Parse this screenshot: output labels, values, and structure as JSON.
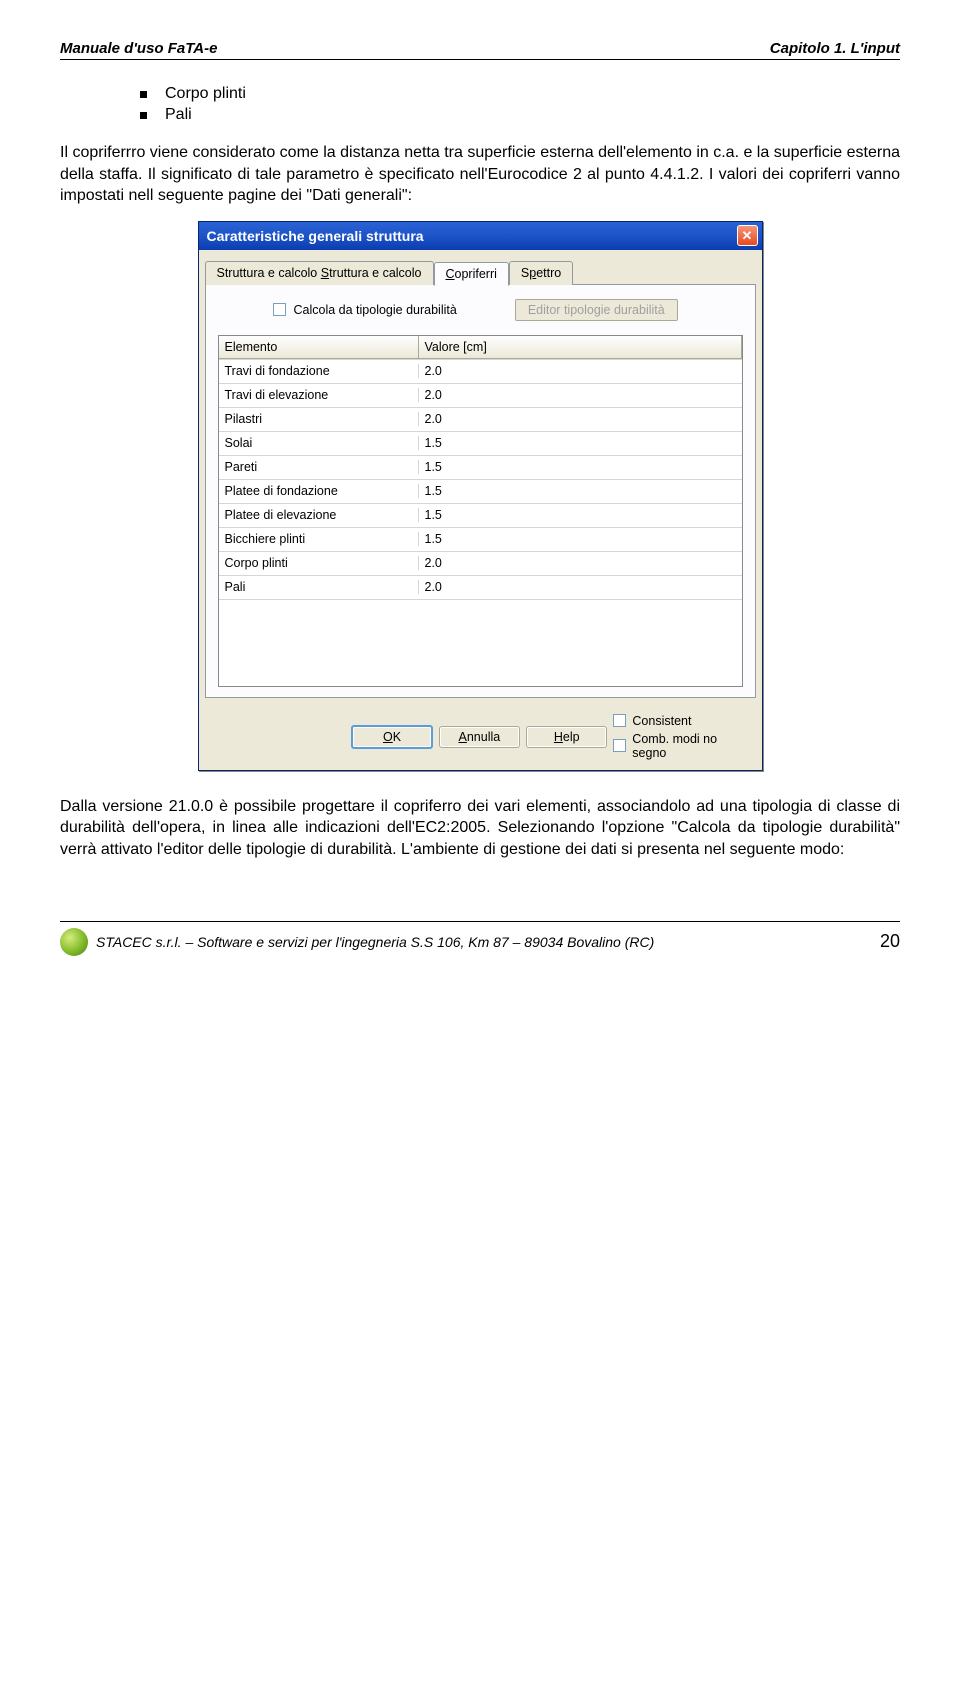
{
  "header": {
    "left": "Manuale d'uso FaTA-e",
    "right": "Capitolo 1. L'input"
  },
  "bullets": [
    "Corpo plinti",
    "Pali"
  ],
  "para1": "Il copriferrro viene considerato come la distanza netta tra superficie esterna dell'elemento in c.a. e la superficie esterna della staffa. Il significato di tale parametro è specificato nell'Eurocodice 2 al punto 4.4.1.2. I valori dei copriferri vanno impostati nell seguente pagine dei \"Dati generali\":",
  "dialog": {
    "title": "Caratteristiche generali struttura",
    "tabs": {
      "t1": "Struttura e calcolo",
      "t2": "Copriferri",
      "t3": "Spettro"
    },
    "chk_label": "Calcola da tipologie durabilità",
    "editor_btn": "Editor tipologie durabilità",
    "col1": "Elemento",
    "col2": "Valore [cm]",
    "rows": [
      {
        "k": "Travi di fondazione",
        "v": "2.0"
      },
      {
        "k": "Travi di elevazione",
        "v": "2.0"
      },
      {
        "k": "Pilastri",
        "v": "2.0"
      },
      {
        "k": "Solai",
        "v": "1.5"
      },
      {
        "k": "Pareti",
        "v": "1.5"
      },
      {
        "k": "Platee di fondazione",
        "v": "1.5"
      },
      {
        "k": "Platee di elevazione",
        "v": "1.5"
      },
      {
        "k": "Bicchiere plinti",
        "v": "1.5"
      },
      {
        "k": "Corpo plinti",
        "v": "2.0"
      },
      {
        "k": "Pali",
        "v": "2.0"
      }
    ],
    "ok": "OK",
    "cancel": "Annulla",
    "help": "Help",
    "rc1": "Consistent",
    "rc2": "Comb. modi no segno"
  },
  "para2": "Dalla versione 21.0.0 è possibile progettare il copriferro dei vari elementi, associandolo ad una tipologia di classe di durabilità dell'opera, in linea alle indicazioni dell'EC2:2005. Selezionando l'opzione \"Calcola da tipologie durabilità\" verrà attivato l'editor delle tipologie di durabilità. L'ambiente di gestione dei dati si presenta nel seguente modo:",
  "footer": {
    "text": "STACEC s.r.l. – Software e servizi per l'ingegneria  S.S 106, Km 87 – 89034 Bovalino (RC)",
    "page": "20"
  }
}
